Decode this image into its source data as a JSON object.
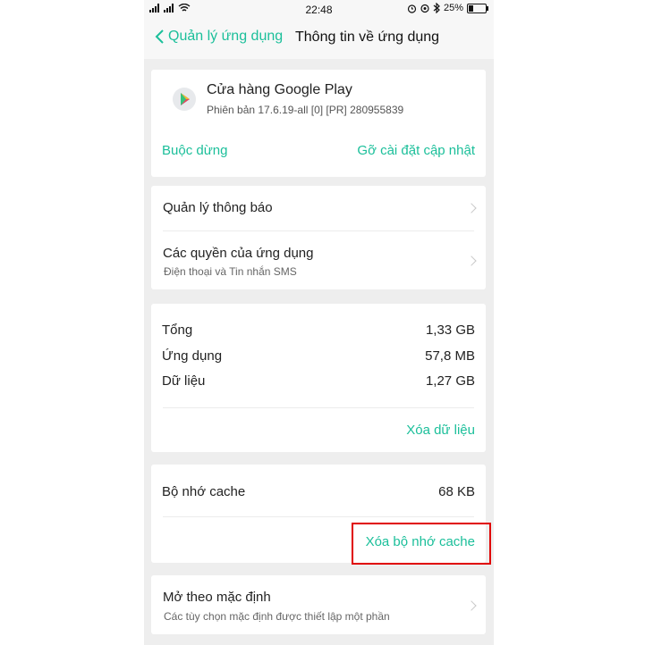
{
  "status_bar": {
    "left_icons": [
      "signal-icon",
      "signal-icon",
      "wifi-icon"
    ],
    "time": "22:48",
    "right_icons": [
      "alarm-icon",
      "location-icon",
      "bluetooth-icon"
    ],
    "battery_percent": "25%",
    "battery_level": 0.25
  },
  "header": {
    "back_label": "Quản lý ứng dụng",
    "title": "Thông tin về ứng dụng"
  },
  "app": {
    "name": "Cửa hàng Google Play",
    "version": "Phiên bản 17.6.19-all [0] [PR] 280955839",
    "icon": "google-play-icon",
    "force_stop_label": "Buộc dừng",
    "uninstall_updates_label": "Gỡ cài đặt cập nhật"
  },
  "settings": {
    "notifications_label": "Quản lý thông báo",
    "permissions_label": "Các quyền của ứng dụng",
    "permissions_sub": "Điện thoại và Tin nhắn SMS"
  },
  "storage": {
    "rows": [
      {
        "label": "Tổng",
        "value": "1,33 GB"
      },
      {
        "label": "Ứng dụng",
        "value": "57,8 MB"
      },
      {
        "label": "Dữ liệu",
        "value": "1,27 GB"
      }
    ],
    "clear_data_label": "Xóa dữ liệu"
  },
  "cache": {
    "label": "Bộ nhớ cache",
    "value": "68 KB",
    "clear_cache_label": "Xóa bộ nhớ cache"
  },
  "defaults": {
    "label": "Mở theo mặc định",
    "sub": "Các tùy chọn mặc định được thiết lập một phần"
  },
  "colors": {
    "accent": "#1bbf9a",
    "highlight": "#e00000"
  }
}
